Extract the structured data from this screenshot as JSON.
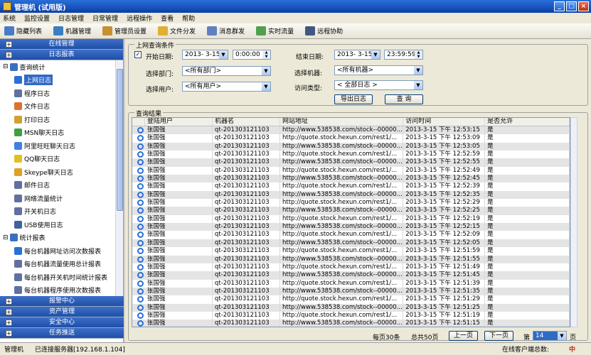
{
  "window": {
    "title": "管理机 (试用版)"
  },
  "menu": [
    "系统",
    "监控设置",
    "日志管理",
    "日常管理",
    "远程操作",
    "查看",
    "帮助"
  ],
  "toolbar": [
    {
      "label": "隐藏列表",
      "icon": "list-icon",
      "color": "#4a7ac8"
    },
    {
      "label": "机器管理",
      "icon": "computer-icon",
      "color": "#3a80c0"
    },
    {
      "label": "管理员设置",
      "icon": "users-icon",
      "color": "#c89030"
    },
    {
      "label": "文件分发",
      "icon": "folder-icon",
      "color": "#e0b030"
    },
    {
      "label": "消息群发",
      "icon": "message-icon",
      "color": "#6080c0"
    },
    {
      "label": "实时流量",
      "icon": "chart-icon",
      "color": "#50a050"
    },
    {
      "label": "远程协助",
      "icon": "monitor-icon",
      "color": "#405880"
    }
  ],
  "left": {
    "panels_top": [
      "在线管理",
      "日志报表"
    ],
    "tree": [
      {
        "label": "查询统计",
        "level": 0,
        "icon": "tree-folder-icon",
        "color": "#3a70c0",
        "selected": false
      },
      {
        "label": "上网日志",
        "level": 1,
        "icon": "globe-icon",
        "color": "#2a6fd8",
        "selected": true
      },
      {
        "label": "程序日志",
        "level": 1,
        "icon": "program-icon",
        "color": "#6070a0",
        "selected": false
      },
      {
        "label": "文件日志",
        "level": 1,
        "icon": "file-icon",
        "color": "#e07030",
        "selected": false
      },
      {
        "label": "打印日志",
        "level": 1,
        "icon": "print-icon",
        "color": "#d0a030",
        "selected": false
      },
      {
        "label": "MSN聊天日志",
        "level": 1,
        "icon": "msn-icon",
        "color": "#40a040",
        "selected": false
      },
      {
        "label": "阿里旺旺聊天日志",
        "level": 1,
        "icon": "wangwang-icon",
        "color": "#4080e0",
        "selected": false
      },
      {
        "label": "QQ聊天日志",
        "level": 1,
        "icon": "qq-icon",
        "color": "#e0c020",
        "selected": false
      },
      {
        "label": "Skeype聊天日志",
        "level": 1,
        "icon": "skype-icon",
        "color": "#e0a020",
        "selected": false
      },
      {
        "label": "邮件日志",
        "level": 1,
        "icon": "mail-icon",
        "color": "#6070a0",
        "selected": false
      },
      {
        "label": "网络流量统计",
        "level": 1,
        "icon": "network-icon",
        "color": "#6070a0",
        "selected": false
      },
      {
        "label": "开关机日志",
        "level": 1,
        "icon": "power-icon",
        "color": "#6070a0",
        "selected": false
      },
      {
        "label": "USB使用日志",
        "level": 1,
        "icon": "usb-icon",
        "color": "#4060a0",
        "selected": false
      },
      {
        "label": "统计报表",
        "level": 0,
        "icon": "tree-folder-icon",
        "color": "#3a70c0",
        "selected": false
      },
      {
        "label": "每台机器网址访问次数报表",
        "level": 1,
        "icon": "globe-icon",
        "color": "#2a6fd8",
        "selected": false
      },
      {
        "label": "每台机器流量使用总计报表",
        "level": 1,
        "icon": "network-icon",
        "color": "#6070a0",
        "selected": false
      },
      {
        "label": "每台机器开关机时间统计报表",
        "level": 1,
        "icon": "power-icon",
        "color": "#6070a0",
        "selected": false
      },
      {
        "label": "每台机器程序使用次数报表",
        "level": 1,
        "icon": "program-icon",
        "color": "#6070a0",
        "selected": false
      }
    ],
    "panels_bottom": [
      "报警中心",
      "资产管理",
      "安全中心",
      "任务推送"
    ]
  },
  "query": {
    "group_label": "上网查询条件",
    "start_label": "开始日期:",
    "start_date": "2013- 3-15",
    "start_time": "0:00:00",
    "end_label": "结束日期:",
    "end_date": "2013- 3-15",
    "end_time": "23:59:59",
    "dept_label": "选择部门:",
    "dept_value": "<所有部门>",
    "machine_label": "选择机器:",
    "machine_value": "<所有机器>",
    "user_label": "选择用户:",
    "user_value": "<所有用户>",
    "type_label": "访问类型:",
    "type_value": "< 全部日志 >",
    "export_btn": "导出日志",
    "query_btn": "查 询"
  },
  "results": {
    "group_label": "查询结果",
    "columns": [
      "登陆用户",
      "机器名",
      "网站地址",
      "访问时间",
      "是否允许"
    ],
    "rows": [
      [
        "张国强",
        "qt-201303121103",
        "http://www.538538.com/stock--00000...",
        "2013-3-15 下午 12:53:15",
        "是"
      ],
      [
        "张国强",
        "qt-201303121103",
        "http://quote.stock.hexun.com/rest1/...",
        "2013-3-15 下午 12:53:09",
        "是"
      ],
      [
        "张国强",
        "qt-201303121103",
        "http://www.538538.com/stock--00000...",
        "2013-3-15 下午 12:53:05",
        "是"
      ],
      [
        "张国强",
        "qt-201303121103",
        "http://quote.stock.hexun.com/rest1/...",
        "2013-3-15 下午 12:52:59",
        "是"
      ],
      [
        "张国强",
        "qt-201303121103",
        "http://www.538538.com/stock--00000...",
        "2013-3-15 下午 12:52:55",
        "是"
      ],
      [
        "张国强",
        "qt-201303121103",
        "http://quote.stock.hexun.com/rest1/...",
        "2013-3-15 下午 12:52:49",
        "是"
      ],
      [
        "张国强",
        "qt-201303121103",
        "http://www.538538.com/stock--00000...",
        "2013-3-15 下午 12:52:45",
        "是"
      ],
      [
        "张国强",
        "qt-201303121103",
        "http://quote.stock.hexun.com/rest1/...",
        "2013-3-15 下午 12:52:39",
        "是"
      ],
      [
        "张国强",
        "qt-201303121103",
        "http://www.538538.com/stock--00000...",
        "2013-3-15 下午 12:52:35",
        "是"
      ],
      [
        "张国强",
        "qt-201303121103",
        "http://quote.stock.hexun.com/rest1/...",
        "2013-3-15 下午 12:52:29",
        "是"
      ],
      [
        "张国强",
        "qt-201303121103",
        "http://www.538538.com/stock--00000...",
        "2013-3-15 下午 12:52:25",
        "是"
      ],
      [
        "张国强",
        "qt-201303121103",
        "http://quote.stock.hexun.com/rest1/...",
        "2013-3-15 下午 12:52:19",
        "是"
      ],
      [
        "张国强",
        "qt-201303121103",
        "http://www.538538.com/stock--00000...",
        "2013-3-15 下午 12:52:15",
        "是"
      ],
      [
        "张国强",
        "qt-201303121103",
        "http://quote.stock.hexun.com/rest1/...",
        "2013-3-15 下午 12:52:09",
        "是"
      ],
      [
        "张国强",
        "qt-201303121103",
        "http://www.538538.com/stock--00000...",
        "2013-3-15 下午 12:52:05",
        "是"
      ],
      [
        "张国强",
        "qt-201303121103",
        "http://quote.stock.hexun.com/rest1/...",
        "2013-3-15 下午 12:51:59",
        "是"
      ],
      [
        "张国强",
        "qt-201303121103",
        "http://www.538538.com/stock--00000...",
        "2013-3-15 下午 12:51:55",
        "是"
      ],
      [
        "张国强",
        "qt-201303121103",
        "http://quote.stock.hexun.com/rest1/...",
        "2013-3-15 下午 12:51:49",
        "是"
      ],
      [
        "张国强",
        "qt-201303121103",
        "http://www.538538.com/stock--00000...",
        "2013-3-15 下午 12:51:45",
        "是"
      ],
      [
        "张国强",
        "qt-201303121103",
        "http://quote.stock.hexun.com/rest1/...",
        "2013-3-15 下午 12:51:39",
        "是"
      ],
      [
        "张国强",
        "qt-201303121103",
        "http://www.538538.com/stock--00000...",
        "2013-3-15 下午 12:51:35",
        "是"
      ],
      [
        "张国强",
        "qt-201303121103",
        "http://quote.stock.hexun.com/rest1/...",
        "2013-3-15 下午 12:51:29",
        "是"
      ],
      [
        "张国强",
        "qt-201303121103",
        "http://www.538538.com/stock--00000...",
        "2013-3-15 下午 12:51:25",
        "是"
      ],
      [
        "张国强",
        "qt-201303121103",
        "http://quote.stock.hexun.com/rest1/...",
        "2013-3-15 下午 12:51:19",
        "是"
      ],
      [
        "张国强",
        "qt-201303121103",
        "http://www.538538.com/stock--00000...",
        "2013-3-15 下午 12:51:15",
        "是"
      ]
    ]
  },
  "pager": {
    "per_page": "每页30条",
    "total": "总共50页",
    "prev": "上一页",
    "next": "下一页",
    "page_label": "第",
    "page_value": "14",
    "page_unit": "页"
  },
  "status": {
    "app": "管理机",
    "server": "已连接服务器[192.168.1.104]",
    "online": "在线客户端总数:",
    "ime": "中"
  }
}
